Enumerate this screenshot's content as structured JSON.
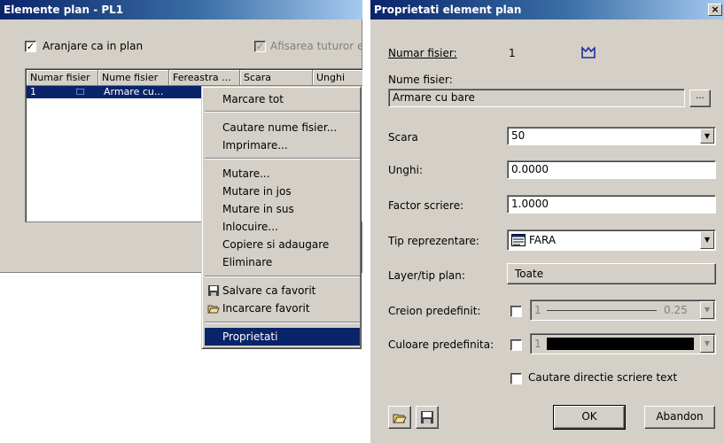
{
  "left_window": {
    "title": "Elemente plan - PL1",
    "arrange_checkbox": {
      "label": "Aranjare ca in plan",
      "checked": true
    },
    "show_all_checkbox": {
      "label": "Afisarea tuturor ele",
      "checked": true,
      "disabled": true
    },
    "columns": [
      "Numar fisier",
      "Nume fisier",
      "Fereastra ...",
      "Scara",
      "Unghi"
    ],
    "rows": [
      {
        "number": "1",
        "name": "Armare cu..."
      }
    ]
  },
  "context_menu": {
    "items": {
      "mark_all": "Marcare tot",
      "search_name": "Cautare nume fisier...",
      "print": "Imprimare...",
      "move": "Mutare...",
      "move_down": "Mutare in jos",
      "move_up": "Mutare in sus",
      "replace": "Inlocuire...",
      "copy_add": "Copiere si adaugare",
      "delete": "Eliminare",
      "save_favorite": "Salvare ca favorit",
      "load_favorite": "Incarcare favorit",
      "properties": "Proprietati"
    },
    "selected": "properties"
  },
  "dialog": {
    "title": "Proprietati element plan",
    "close_glyph": "×",
    "file_number": {
      "label": "Numar fisier:",
      "value": "1"
    },
    "file_name": {
      "label": "Nume fisier:",
      "value": "Armare cu bare",
      "browse_label": "..."
    },
    "scale": {
      "label": "Scara",
      "value": "50"
    },
    "angle": {
      "label": "Unghi:",
      "value": "0.0000"
    },
    "write_factor": {
      "label": "Factor scriere:",
      "value": "1.0000"
    },
    "representation": {
      "label": "Tip reprezentare:",
      "value": "FARA"
    },
    "layer": {
      "label": "Layer/tip plan:",
      "value": "Toate"
    },
    "pen": {
      "label": "Creion predefinit:",
      "number": "1",
      "thickness": "0.25",
      "checked": false
    },
    "color": {
      "label": "Culoare predefinita:",
      "number": "1",
      "swatch": "#000000",
      "checked": false
    },
    "text_direction": {
      "label": "Cautare directie scriere text",
      "checked": false
    },
    "ok_label": "OK",
    "cancel_label": "Abandon"
  },
  "colors": {
    "titlebar_start": "#0a246a",
    "titlebar_end": "#a6caf0",
    "selection": "#0a246a",
    "face": "#d4d0c8"
  }
}
